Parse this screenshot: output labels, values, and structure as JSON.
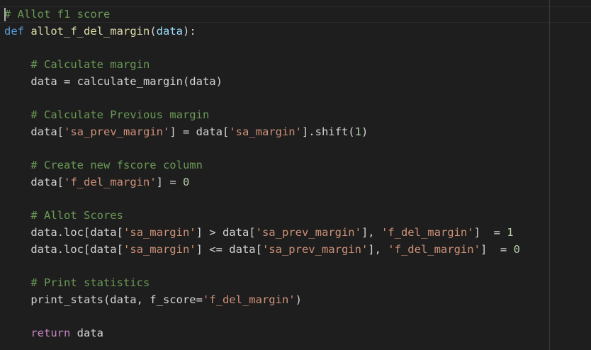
{
  "editor": {
    "background": "#1e1e1e",
    "colors": {
      "comment": "#6a9955",
      "keyword": "#569cd6",
      "control": "#c586c0",
      "function": "#dcdcaa",
      "variable": "#9cdcfe",
      "plain": "#d4d4d4",
      "string": "#ce9178",
      "number": "#b5cea8"
    },
    "lines": [
      [
        {
          "t": "# Allot f1 score",
          "c": "comment"
        }
      ],
      [
        {
          "t": "def",
          "c": "keyword"
        },
        {
          "t": " ",
          "c": "plain"
        },
        {
          "t": "allot_f_del_margin",
          "c": "func"
        },
        {
          "t": "(",
          "c": "plain"
        },
        {
          "t": "data",
          "c": "var"
        },
        {
          "t": "):",
          "c": "plain"
        }
      ],
      [],
      [
        {
          "t": "    ",
          "c": "plain"
        },
        {
          "t": "# Calculate margin",
          "c": "comment"
        }
      ],
      [
        {
          "t": "    data = calculate_margin(data)",
          "c": "plain"
        }
      ],
      [],
      [
        {
          "t": "    ",
          "c": "plain"
        },
        {
          "t": "# Calculate Previous margin",
          "c": "comment"
        }
      ],
      [
        {
          "t": "    data[",
          "c": "plain"
        },
        {
          "t": "'sa_prev_margin'",
          "c": "string"
        },
        {
          "t": "] = data[",
          "c": "plain"
        },
        {
          "t": "'sa_margin'",
          "c": "string"
        },
        {
          "t": "].shift(",
          "c": "plain"
        },
        {
          "t": "1",
          "c": "number"
        },
        {
          "t": ")",
          "c": "plain"
        }
      ],
      [],
      [
        {
          "t": "    ",
          "c": "plain"
        },
        {
          "t": "# Create new fscore column",
          "c": "comment"
        }
      ],
      [
        {
          "t": "    data[",
          "c": "plain"
        },
        {
          "t": "'f_del_margin'",
          "c": "string"
        },
        {
          "t": "] = ",
          "c": "plain"
        },
        {
          "t": "0",
          "c": "number"
        }
      ],
      [],
      [
        {
          "t": "    ",
          "c": "plain"
        },
        {
          "t": "# Allot Scores",
          "c": "comment"
        }
      ],
      [
        {
          "t": "    data.loc[data[",
          "c": "plain"
        },
        {
          "t": "'sa_margin'",
          "c": "string"
        },
        {
          "t": "] > data[",
          "c": "plain"
        },
        {
          "t": "'sa_prev_margin'",
          "c": "string"
        },
        {
          "t": "], ",
          "c": "plain"
        },
        {
          "t": "'f_del_margin'",
          "c": "string"
        },
        {
          "t": "]  = ",
          "c": "plain"
        },
        {
          "t": "1",
          "c": "number"
        }
      ],
      [
        {
          "t": "    data.loc[data[",
          "c": "plain"
        },
        {
          "t": "'sa_margin'",
          "c": "string"
        },
        {
          "t": "] <= data[",
          "c": "plain"
        },
        {
          "t": "'sa_prev_margin'",
          "c": "string"
        },
        {
          "t": "], ",
          "c": "plain"
        },
        {
          "t": "'f_del_margin'",
          "c": "string"
        },
        {
          "t": "]  = ",
          "c": "plain"
        },
        {
          "t": "0",
          "c": "number"
        }
      ],
      [],
      [
        {
          "t": "    ",
          "c": "plain"
        },
        {
          "t": "# Print statistics",
          "c": "comment"
        }
      ],
      [
        {
          "t": "    print_stats(data, f_score=",
          "c": "plain"
        },
        {
          "t": "'f_del_margin'",
          "c": "string"
        },
        {
          "t": ")",
          "c": "plain"
        }
      ],
      [],
      [
        {
          "t": "    ",
          "c": "plain"
        },
        {
          "t": "return",
          "c": "control"
        },
        {
          "t": " data",
          "c": "plain"
        }
      ]
    ]
  }
}
